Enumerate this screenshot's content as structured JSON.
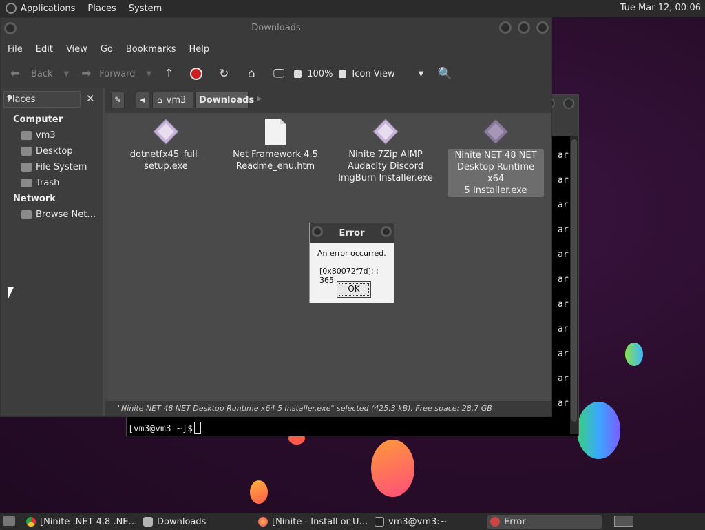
{
  "top_panel": {
    "menus": [
      "Applications",
      "Places",
      "System"
    ],
    "clock": "Tue Mar 12, 00:06"
  },
  "terminal": {
    "lines_right": [
      "ar",
      "ar",
      "ar",
      "ar",
      "ar",
      "ar",
      "ar",
      "ar",
      "ar",
      "ar",
      "ar"
    ],
    "prompt": "[vm3@vm3 ~]$"
  },
  "file_manager": {
    "title": "Downloads",
    "menu": [
      "File",
      "Edit",
      "View",
      "Go",
      "Bookmarks",
      "Help"
    ],
    "toolbar": {
      "back": "Back",
      "forward": "Forward",
      "zoom": "100%",
      "view_mode": "Icon View"
    },
    "sidebar": {
      "header": "Places",
      "sections": [
        {
          "title": "Computer",
          "items": [
            "vm3",
            "Desktop",
            "File System",
            "Trash"
          ]
        },
        {
          "title": "Network",
          "items": [
            "Browse Net…"
          ]
        }
      ]
    },
    "path": [
      "vm3",
      "Downloads"
    ],
    "files": [
      {
        "name": "dotnetfx45_full_\nsetup.exe",
        "type": "exe",
        "selected": false
      },
      {
        "name": "Net Framework 4.5\nReadme_enu.htm",
        "type": "htm",
        "selected": false
      },
      {
        "name": "Ninite 7Zip AIMP\nAudacity Discord\nImgBurn Installer.exe",
        "type": "exe",
        "selected": false
      },
      {
        "name": "Ninite NET 48 NET\nDesktop Runtime x64\n5 Installer.exe",
        "type": "exe",
        "selected": true
      }
    ],
    "status": "\"Ninite NET 48 NET Desktop Runtime x64 5 Installer.exe\" selected (425.3 kB), Free space: 28.7 GB"
  },
  "error_dialog": {
    "title": "Error",
    "message": "An error occurred.",
    "code": "[0x80072f7d]; ; 365",
    "ok_label": "OK"
  },
  "taskbar": {
    "tasks": [
      {
        "label": "[Ninite .NET 4.8 .NE…",
        "icon": "chrome-icon",
        "active": false
      },
      {
        "label": "Downloads",
        "icon": "folder-icon",
        "active": false
      },
      {
        "label": "[Ninite - Install or U…",
        "icon": "firefox-icon",
        "active": false
      },
      {
        "label": "vm3@vm3:~",
        "icon": "terminal-icon",
        "active": false
      },
      {
        "label": "Error",
        "icon": "error-icon",
        "active": true
      }
    ]
  },
  "colors": {
    "panel": "#2b2b2b",
    "window": "#474747",
    "selection": "#6d6d6d",
    "desktop": "#2a0d2c"
  }
}
